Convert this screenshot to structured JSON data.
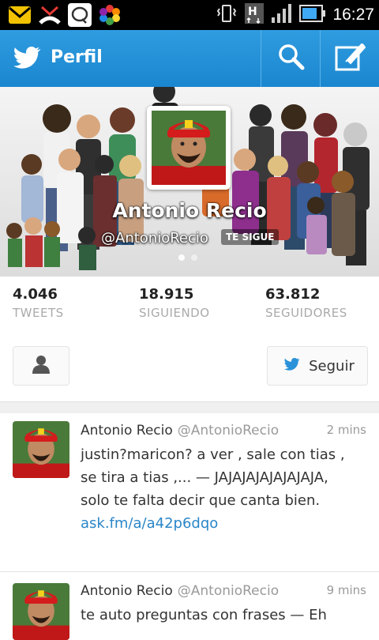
{
  "status_bar": {
    "time": "16:27",
    "icons": [
      "mail-icon",
      "missed-call-icon",
      "chat-icon",
      "photos-icon",
      "vibrate-icon",
      "h-signal-icon",
      "signal-bars-icon",
      "battery-icon"
    ]
  },
  "action_bar": {
    "title": "Perfil",
    "icons": [
      "twitter-bird-icon",
      "search-icon",
      "compose-icon"
    ],
    "accent": "#2a92d8"
  },
  "profile": {
    "name": "Antonio Recio",
    "handle": "@AntonioRecio",
    "follows_you": "TE SIGUE"
  },
  "stats": [
    {
      "value": "4.046",
      "label": "TWEETS"
    },
    {
      "value": "18.915",
      "label": "SIGUIENDO"
    },
    {
      "value": "63.812",
      "label": "SEGUIDORES"
    }
  ],
  "actions": {
    "follow_label": "Seguir"
  },
  "tweets": [
    {
      "name": "Antonio Recio",
      "handle": "@AntonioRecio",
      "time": "2 mins",
      "text": "justin?maricon? a ver , sale con tias , se tira a tias ,... — JAJAJAJAJAJAJAJA, solo te falta decir que canta bien. ",
      "link": "ask.fm/a/a42p6dqo"
    },
    {
      "name": "Antonio Recio",
      "handle": "@AntonioRecio",
      "time": "9 mins",
      "text": "te auto preguntas con frases — Eh"
    }
  ]
}
